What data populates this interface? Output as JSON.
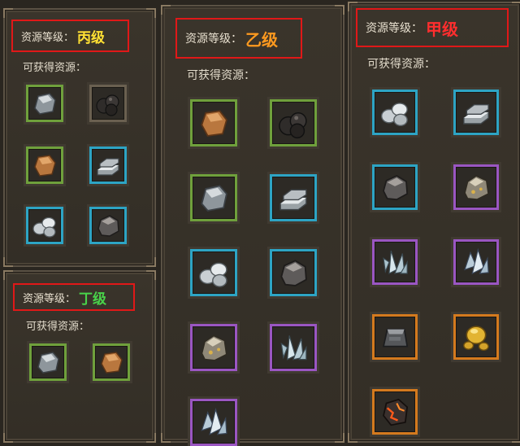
{
  "panels": {
    "bing": {
      "title_prefix": "资源等级：",
      "grade": "丙级",
      "grade_color": "#ffe033",
      "subtitle": "可获得资源：",
      "items": [
        {
          "icon": "stone-ore-icon",
          "rarity": "green"
        },
        {
          "icon": "coal-ore-icon",
          "rarity": "none"
        },
        {
          "icon": "copper-ore-icon",
          "rarity": "green"
        },
        {
          "icon": "silver-ingot-icon",
          "rarity": "blue"
        },
        {
          "icon": "white-pebbles-icon",
          "rarity": "blue"
        },
        {
          "icon": "dark-ore-icon",
          "rarity": "blue"
        }
      ]
    },
    "ding": {
      "title_prefix": "资源等级：",
      "grade": "丁级",
      "grade_color": "#49d24a",
      "subtitle": "可获得资源：",
      "items": [
        {
          "icon": "stone-ore-icon",
          "rarity": "green"
        },
        {
          "icon": "copper-ore-icon",
          "rarity": "green"
        }
      ]
    },
    "yi": {
      "title_prefix": "资源等级：",
      "grade": "乙级",
      "grade_color": "#ff9a1f",
      "subtitle": "可获得资源：",
      "items": [
        {
          "icon": "copper-ore-icon",
          "rarity": "green"
        },
        {
          "icon": "coal-ore-icon",
          "rarity": "green"
        },
        {
          "icon": "stone-ore-icon",
          "rarity": "green"
        },
        {
          "icon": "silver-ingot-icon",
          "rarity": "blue"
        },
        {
          "icon": "white-pebbles-icon",
          "rarity": "blue"
        },
        {
          "icon": "dark-ore-icon",
          "rarity": "blue"
        },
        {
          "icon": "gold-speck-ore-icon",
          "rarity": "purple"
        },
        {
          "icon": "crystal-cluster-icon",
          "rarity": "purple"
        },
        {
          "icon": "crystal-shard-icon",
          "rarity": "purple"
        }
      ]
    },
    "jia": {
      "title_prefix": "资源等级：",
      "grade": "甲级",
      "grade_color": "#ff2e2e",
      "subtitle": "可获得资源：",
      "items": [
        {
          "icon": "white-pebbles-icon",
          "rarity": "blue"
        },
        {
          "icon": "silver-ingot-icon",
          "rarity": "blue"
        },
        {
          "icon": "dark-ore-icon",
          "rarity": "blue"
        },
        {
          "icon": "gold-speck-ore-icon",
          "rarity": "purple"
        },
        {
          "icon": "crystal-cluster-icon",
          "rarity": "purple"
        },
        {
          "icon": "crystal-shard-icon",
          "rarity": "purple"
        },
        {
          "icon": "iron-ingot-icon",
          "rarity": "orange"
        },
        {
          "icon": "gold-nugget-icon",
          "rarity": "orange"
        },
        {
          "icon": "lava-ore-icon",
          "rarity": "orange"
        }
      ]
    }
  }
}
